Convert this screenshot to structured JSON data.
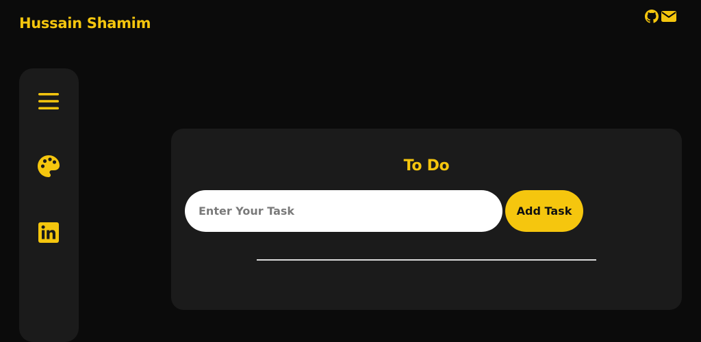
{
  "header": {
    "brand": "Hussain Shamim",
    "icons": [
      "github-icon",
      "mail-icon"
    ]
  },
  "sidebar": {
    "items": [
      {
        "icon": "menu-icon"
      },
      {
        "icon": "palette-icon"
      },
      {
        "icon": "linkedin-icon"
      }
    ]
  },
  "todo": {
    "title": "To Do",
    "input_placeholder": "Enter Your Task",
    "input_value": "",
    "add_label": "Add Task"
  },
  "colors": {
    "background": "#0b0b0b",
    "panel": "#1b1b1b",
    "accent": "#f5c60e",
    "input_bg": "#ffffff"
  }
}
